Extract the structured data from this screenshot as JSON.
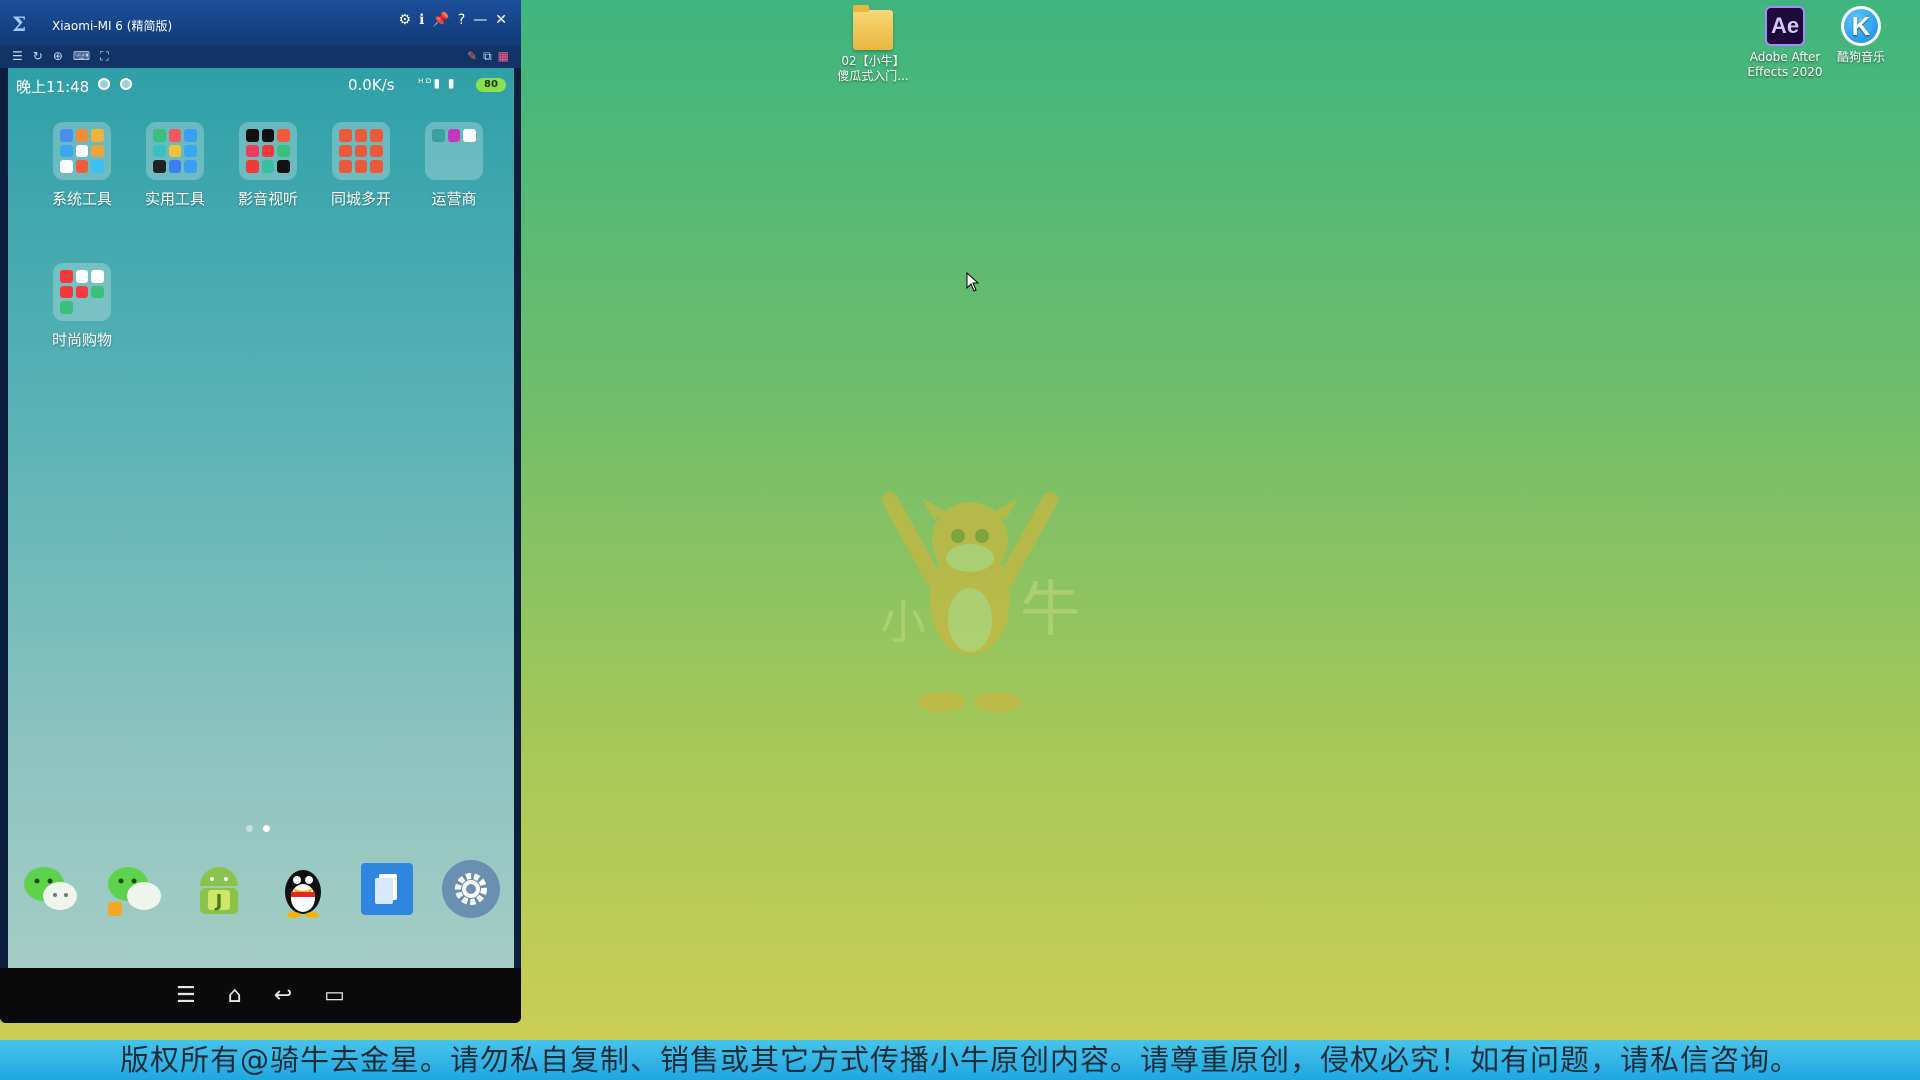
{
  "window": {
    "title": "Xiaomi-MI 6 (精简版)",
    "controls": [
      "⚙",
      "ℹ",
      "📌",
      "?",
      "—",
      "✕"
    ],
    "toolbar_left": [
      "☰",
      "↻",
      "⊕",
      "⌨",
      "⛶"
    ],
    "toolbar_right": [
      "✎",
      "⧉",
      "▦"
    ]
  },
  "phone": {
    "status": {
      "time": "晚上11:48",
      "speed": "0.0K/s",
      "signal": "ᴴᴰ▮ ▮",
      "battery": "80"
    },
    "apps": [
      {
        "label": "系统工具"
      },
      {
        "label": "实用工具"
      },
      {
        "label": "影音视听"
      },
      {
        "label": "同城多开"
      },
      {
        "label": "运营商"
      },
      {
        "label": "时尚购物"
      }
    ],
    "dock": [
      "wechat-icon",
      "wechat-clone-icon",
      "android-j-icon",
      "qq-icon",
      "file-manager-icon",
      "settings-icon"
    ],
    "navbar": [
      "☰",
      "⌂",
      "↩",
      "▭"
    ]
  },
  "desktop": {
    "icons": [
      {
        "name": "folder",
        "label_line1": "02【小牛】",
        "label_line2": "傻瓜式入门..."
      },
      {
        "name": "ae",
        "glyph": "Ae",
        "label_line1": "Adobe After",
        "label_line2": "Effects 2020"
      },
      {
        "name": "kugou",
        "glyph": "K",
        "label_line1": "酷狗音乐",
        "label_line2": ""
      }
    ],
    "mascot": {
      "char_left": "小",
      "char_right": "牛"
    }
  },
  "banner": {
    "text": "版权所有@骑牛去金星。请勿私自复制、销售或其它方式传播小牛原创内容。请尊重原创，侵权必究！如有问题，请私信咨询。"
  },
  "colors": {
    "title_bar": "#1d4f9b",
    "banner": "#1fa7e0",
    "battery": "#8be04e"
  }
}
